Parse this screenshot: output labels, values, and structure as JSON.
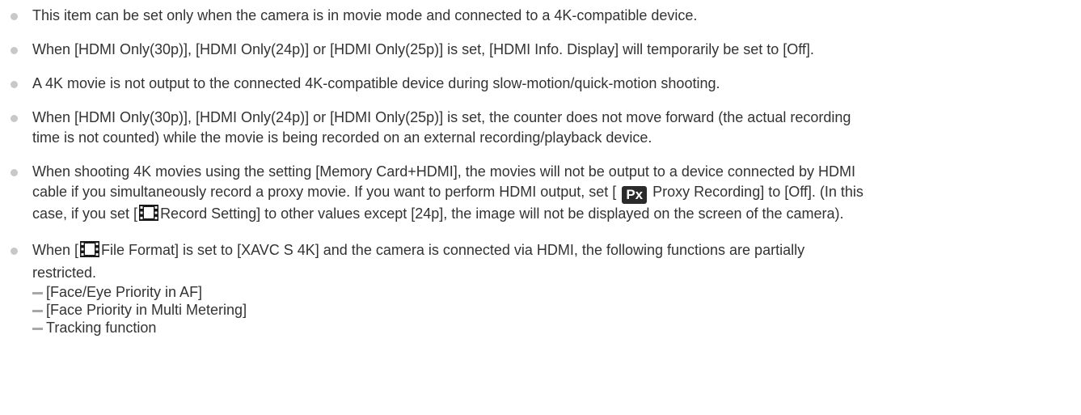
{
  "notes": [
    {
      "text": "This item can be set only when the camera is in movie mode and connected to a 4K-compatible device."
    },
    {
      "text": "When [HDMI Only(30p)], [HDMI Only(24p)] or [HDMI Only(25p)] is set, [HDMI Info. Display] will temporarily be set to [Off]."
    },
    {
      "text": "A 4K movie is not output to the connected 4K-compatible device during slow-motion/quick-motion shooting."
    },
    {
      "line1": "When [HDMI Only(30p)], [HDMI Only(24p)] or [HDMI Only(25p)] is set, the counter does not move forward (the actual recording",
      "line2": "time is not counted) while the movie is being recorded on an external recording/playback device."
    },
    {
      "line1": "When shooting 4K movies using the setting [Memory Card+HDMI], the movies will not be output to a device connected by HDMI",
      "line2a": "cable if you simultaneously record a proxy movie. If you want to perform HDMI output, set [",
      "badge": "Px",
      "line2b": "Proxy Recording] to [Off]. (In this",
      "line3a": "case, if you set [",
      "line3b": "Record Setting] to other values except [24p], the image will not be displayed on the screen of the camera).",
      "icon": "movie-film-icon"
    },
    {
      "line1a": "When [",
      "line1b": "File Format] is set to [XAVC S 4K] and the camera is connected via HDMI, the following functions are partially",
      "line2": "restricted.",
      "icon": "movie-film-icon",
      "subitems": [
        "[Face/Eye Priority in AF]",
        "[Face Priority in Multi Metering]",
        "Tracking function"
      ]
    }
  ]
}
